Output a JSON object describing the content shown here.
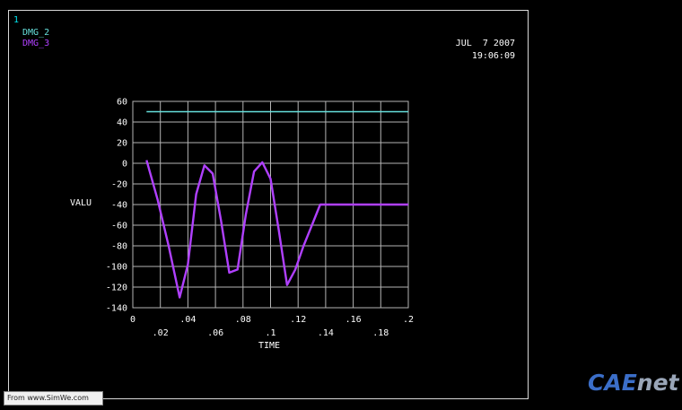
{
  "window_number": "1",
  "date": "JUL  7 2007",
  "time": "19:06:09",
  "brand": {
    "part1": "CAE",
    "part2": "net"
  },
  "watermark": "From www.SimWe.com",
  "colors": {
    "frame": "#d8d8d8",
    "grid": "#b4b4b4",
    "series1": "#66e0dc",
    "series2": "#b040ff"
  },
  "chart_data": {
    "type": "line",
    "xlabel": "TIME",
    "ylabel": "VALU",
    "xlim": [
      0,
      0.2
    ],
    "ylim": [
      -140,
      60
    ],
    "grid": true,
    "legend": "top-left",
    "xticks_lower": [
      {
        "v": 0,
        "label": "0"
      },
      {
        "v": 0.04,
        "label": ".04"
      },
      {
        "v": 0.08,
        "label": ".08"
      },
      {
        "v": 0.12,
        "label": ".12"
      },
      {
        "v": 0.16,
        "label": ".16"
      },
      {
        "v": 0.2,
        "label": ".2"
      }
    ],
    "xticks_upper": [
      {
        "v": 0.02,
        "label": ".02"
      },
      {
        "v": 0.06,
        "label": ".06"
      },
      {
        "v": 0.1,
        "label": ".1"
      },
      {
        "v": 0.14,
        "label": ".14"
      },
      {
        "v": 0.18,
        "label": ".18"
      }
    ],
    "yticks": [
      {
        "v": 60,
        "label": "60"
      },
      {
        "v": 40,
        "label": "40"
      },
      {
        "v": 20,
        "label": "20"
      },
      {
        "v": 0,
        "label": "0"
      },
      {
        "v": -20,
        "label": "-20"
      },
      {
        "v": -40,
        "label": "-40"
      },
      {
        "v": -60,
        "label": "-60"
      },
      {
        "v": -80,
        "label": "-80"
      },
      {
        "v": -100,
        "label": "-100"
      },
      {
        "v": -120,
        "label": "-120"
      },
      {
        "v": -140,
        "label": "-140"
      }
    ],
    "series": [
      {
        "name": "DMG_2",
        "color": "#66e0dc",
        "x": [
          0.01,
          0.2
        ],
        "y": [
          50,
          50
        ]
      },
      {
        "name": "DMG_3",
        "color": "#b040ff",
        "x": [
          0.01,
          0.018,
          0.026,
          0.034,
          0.04,
          0.046,
          0.052,
          0.058,
          0.064,
          0.07,
          0.076,
          0.082,
          0.088,
          0.094,
          0.1,
          0.106,
          0.112,
          0.118,
          0.124,
          0.13,
          0.136,
          0.142,
          0.148,
          0.154,
          0.16,
          0.166,
          0.172,
          0.178,
          0.184,
          0.19,
          0.196,
          0.2
        ],
        "y": [
          3,
          -35,
          -80,
          -130,
          -98,
          -30,
          -2,
          -10,
          -55,
          -106,
          -103,
          -50,
          -8,
          1,
          -15,
          -65,
          -118,
          -103,
          -80,
          -60,
          -40,
          -40,
          -40,
          -40,
          -40,
          -40,
          -40,
          -40,
          -40,
          -40,
          -40,
          -40
        ]
      }
    ]
  }
}
